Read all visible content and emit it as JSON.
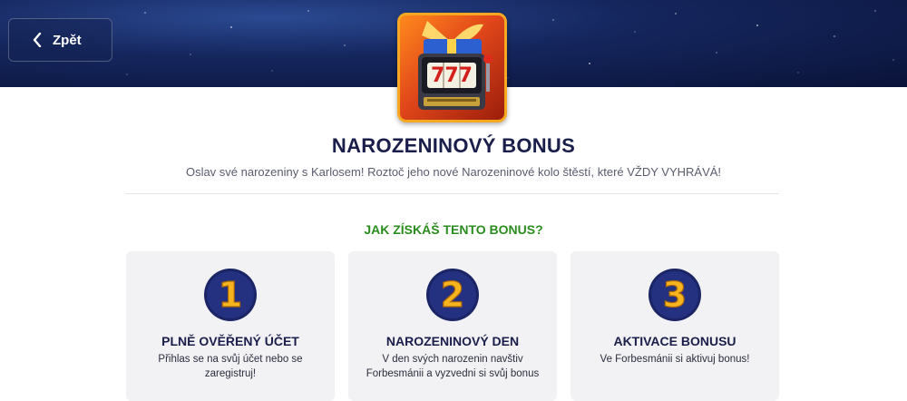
{
  "header": {
    "back_label": "Zpět"
  },
  "bonus": {
    "title": "NAROZENINOVÝ BONUS",
    "subtitle": "Oslav své narozeniny s Karlosem! Roztoč jeho nové Narozeninové kolo štěstí, které VŽDY VYHRÁVÁ!",
    "game_symbols": "777"
  },
  "how_to": {
    "title": "JAK ZÍSKÁŠ TENTO BONUS?",
    "steps": [
      {
        "number": "1",
        "title": "PLNĚ OVĚŘENÝ ÚČET",
        "text": "Přihlas se na svůj účet nebo se zaregistruj!"
      },
      {
        "number": "2",
        "title": "NAROZENINOVÝ DEN",
        "text": "V den svých narozenin navštiv Forbesmánii a vyzvedni si svůj bonus"
      },
      {
        "number": "3",
        "title": "AKTIVACE BONUSU",
        "text": "Ve Forbesmánii si aktivuj bonus!"
      }
    ]
  },
  "colors": {
    "banner": "#15265e",
    "title": "#1a1e4a",
    "accent_green": "#2a8c1e",
    "number_gold": "#f6b51e",
    "number_circle": "#1b2565"
  }
}
